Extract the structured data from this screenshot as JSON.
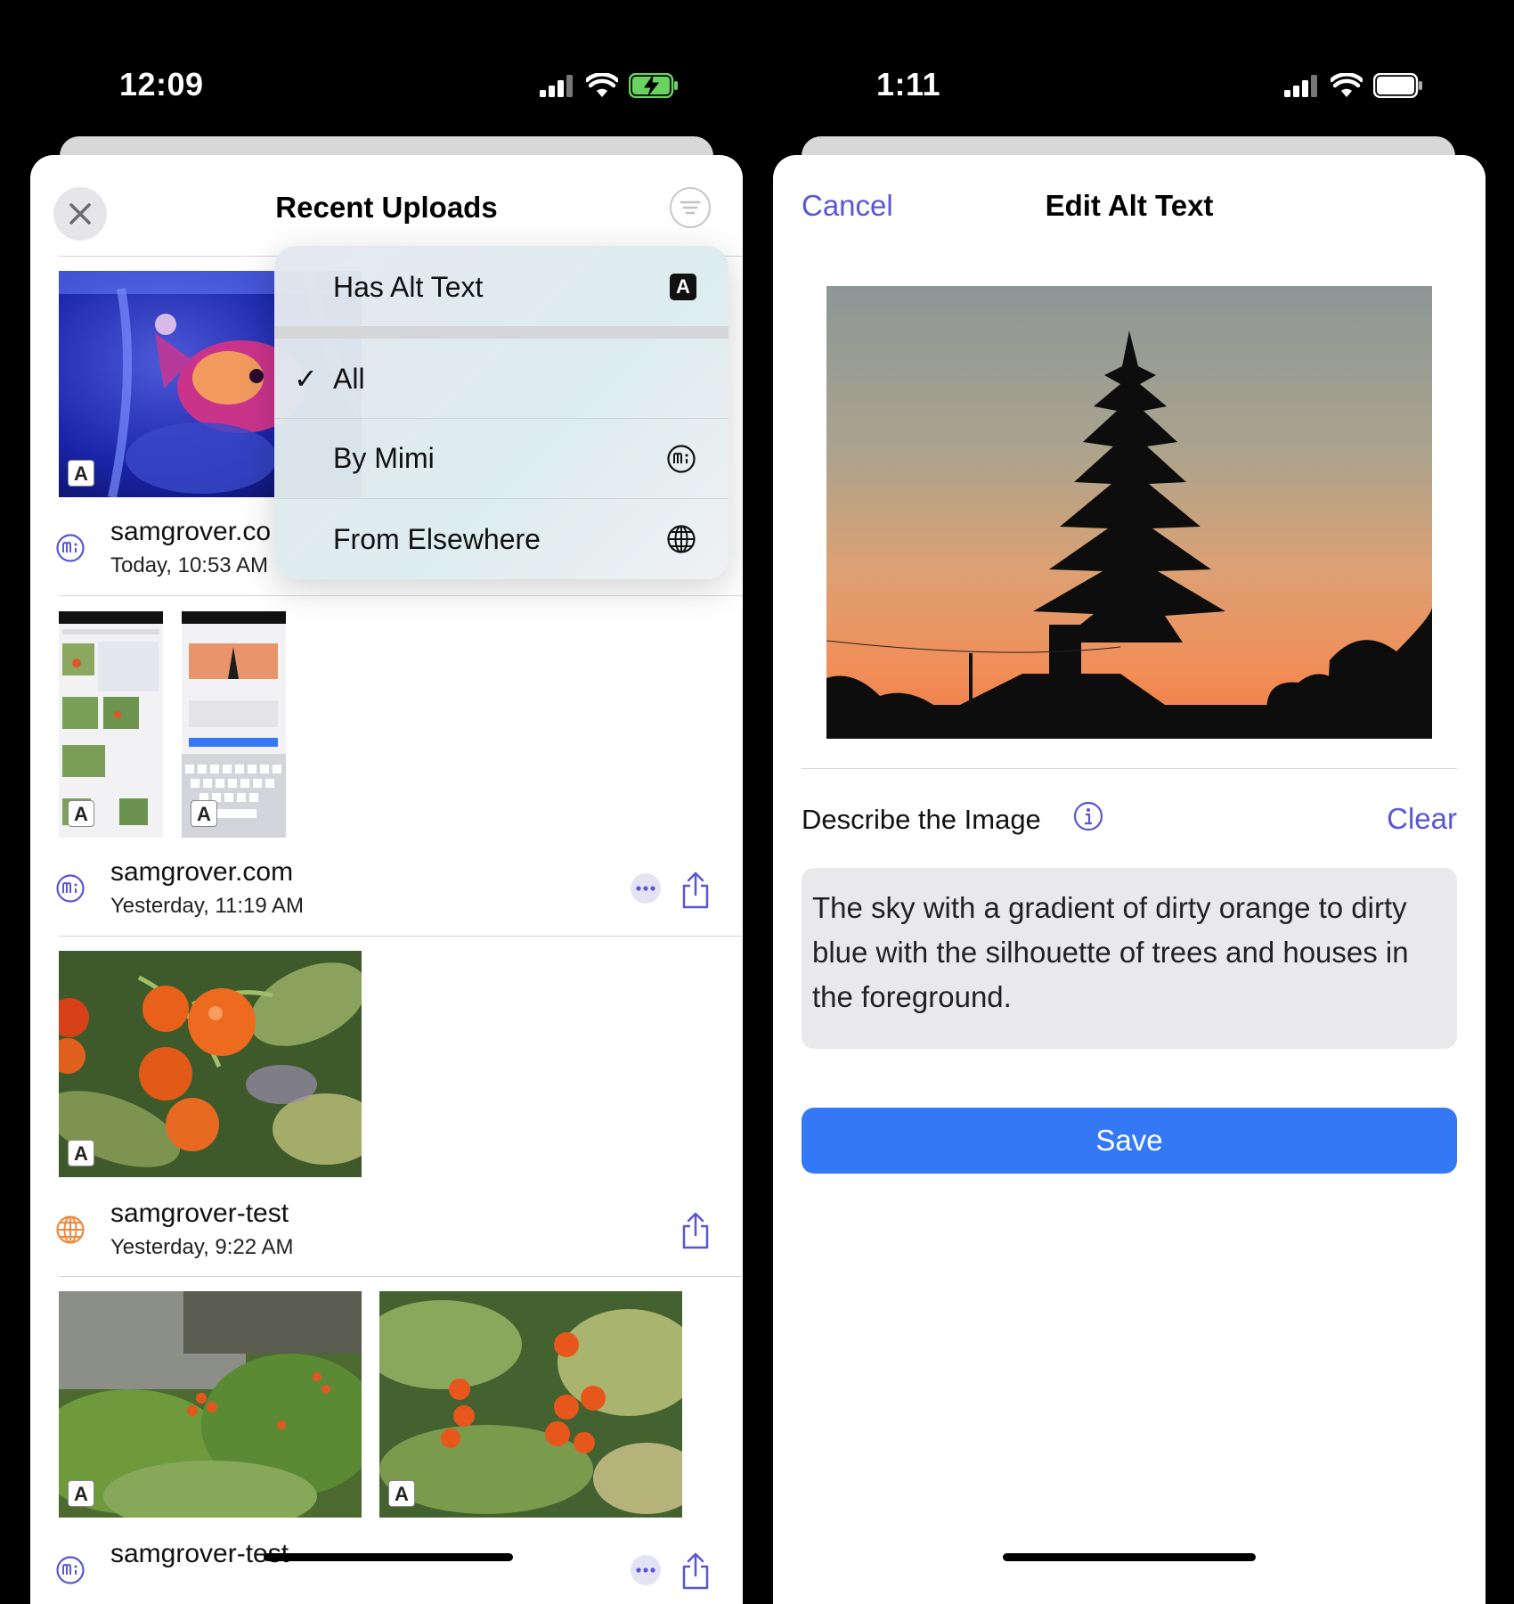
{
  "left_screen": {
    "status_time": "12:09",
    "title": "Recent Uploads",
    "close_icon": "close-icon",
    "filter_icon": "filter-icon",
    "menu": {
      "items": [
        {
          "label": "Has Alt Text",
          "icon": "alt-text-badge-icon",
          "glyph": "A"
        },
        {
          "label": "All",
          "checked": true
        },
        {
          "label": "By Mimi",
          "icon": "mimi-icon"
        },
        {
          "label": "From Elsewhere",
          "icon": "globe-icon"
        }
      ],
      "checkmark": "✓"
    },
    "alt_badge": "A",
    "items": [
      {
        "title": "samgrover.co",
        "date": "Today, 10:53 AM",
        "source": "mimi"
      },
      {
        "title": "samgrover.com",
        "date": "Yesterday, 11:19 AM",
        "source": "mimi"
      },
      {
        "title": "samgrover-test",
        "date": "Yesterday, 9:22 AM",
        "source": "elsewhere"
      },
      {
        "title": "samgrover-test",
        "date": "",
        "source": "mimi"
      }
    ],
    "accent_color": "#5856d6",
    "globe_color": "#f0883a"
  },
  "right_screen": {
    "status_time": "1:11",
    "cancel_label": "Cancel",
    "title": "Edit Alt Text",
    "describe_label": "Describe the Image",
    "info_icon": "info-icon",
    "clear_label": "Clear",
    "alt_text": "The sky with a gradient of dirty orange to dirty blue with the silhouette of trees and houses in the foreground.",
    "save_label": "Save",
    "save_color": "#3478f6"
  }
}
